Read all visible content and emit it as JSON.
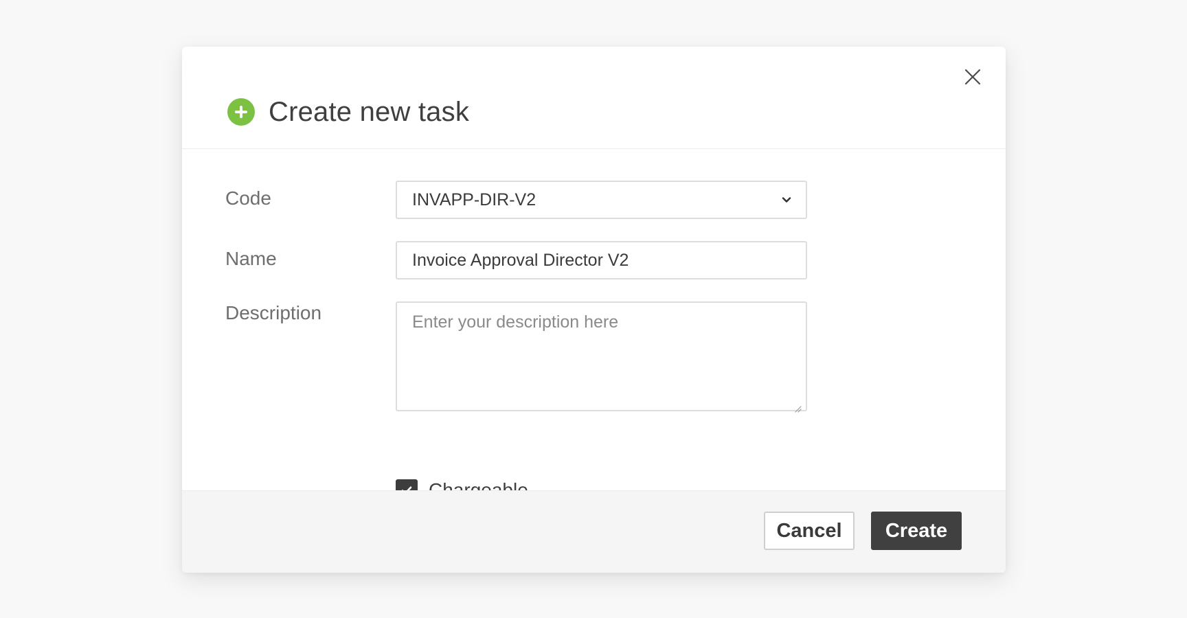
{
  "dialog": {
    "title": "Create new task",
    "title_icon": "plus-circle-icon",
    "close_icon": "close-icon",
    "accent_color": "#7cc142"
  },
  "form": {
    "code": {
      "label": "Code",
      "value": "INVAPP-DIR-V2",
      "icon": "chevron-down-icon"
    },
    "name": {
      "label": "Name",
      "value": "Invoice Approval Director V2"
    },
    "description": {
      "label": "Description",
      "placeholder": "Enter your description here",
      "value": ""
    },
    "chargeable": {
      "label": "Chargeable",
      "checked": true
    }
  },
  "footer": {
    "cancel_label": "Cancel",
    "create_label": "Create",
    "primary_color": "#404040"
  }
}
